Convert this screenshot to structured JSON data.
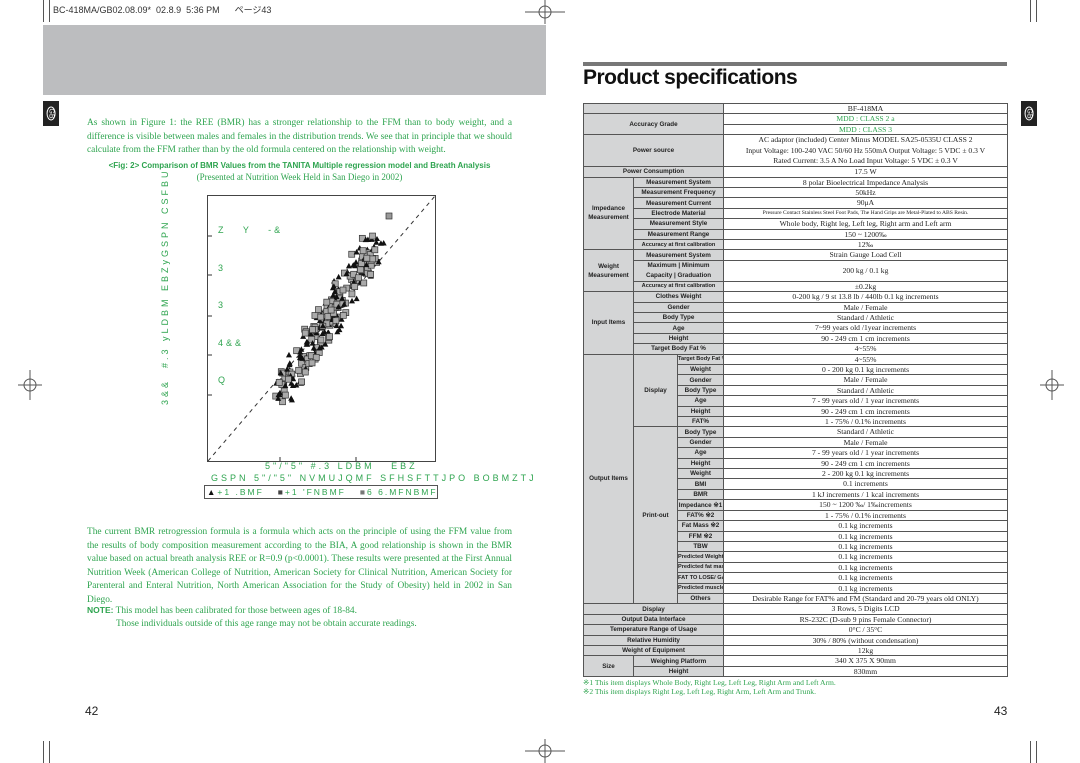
{
  "print_header": "BC-418MA/GB02.08.09*  02.8.9  5:36 PM      ページ43",
  "left_page": {
    "tab": "GB",
    "intro": "As shown in Figure 1: the REE (BMR) has a stronger relationship to the FFM than to body weight, and a difference is visible between males and females in the distribution trends. We see that in principle that we should calculate from the FFM rather than by the old formula centered on the relationship with weight.",
    "figure_caption": "<Fig:  2> Comparison of BMR Values from the TANITA Multiple regression model and Breath Analysis",
    "figure_subcaption": "(Presented at Nutrition Week Held in San Diego in 2002)",
    "figure": {
      "y_label": "3&&  #.3 yLDBM EBZyGSPN CSFBU",
      "inset_lines": [
        "Z   Y   -&",
        "3",
        "3",
        "4&&",
        "Q"
      ],
      "x_label_1": "5\"/\"5\" #.3 LDBM   EBZ",
      "x_label_2": "GSPN 5\"/\"5\" NVMUJQMF SFHSFTTJPO BOBMZTJ",
      "legend": [
        "+1 .BMF",
        "+1 'FNBMF",
        "6 6.MFNBMF"
      ]
    },
    "body": "The current BMR retrogression formula is a formula which acts on the principle of using the FFM value from the results of body composition measurement according to the BIA, A good relationship is shown in the BMR value based on actual breath analysis REE or R=0.9 (p<0.0001). These results were presented at the First Annual Nutrition Week (American College of Nutrition, American Society for Clinical Nutrition, American Society for Parenteral and Enteral Nutrition, North American Association for the Study of Obesity) held in 2002 in San Diego.",
    "note_label": "NOTE:",
    "note_1": "This model has been calibrated for those between ages of 18-84.",
    "note_2": "Those individuals outside of this age range may not be obtain accurate readings.",
    "page_number": "42"
  },
  "right_page": {
    "tab": "GB",
    "title": "Product specifications",
    "page_number": "43",
    "accent_color": "#2ea44f",
    "specs": [
      {
        "label": "",
        "values": [
          "BF-418MA"
        ]
      },
      {
        "label": "Accuracy Grade",
        "values": [
          "MDD : CLASS 2 a",
          "MDD : CLASS 3"
        ],
        "highlight": true
      },
      {
        "label": "Power source",
        "lines": [
          "AC adaptor (included)  Center Minus  MODEL SA25-0535U  CLASS 2",
          "Input Voltage: 100-240 VAC  50/60 Hz  550mA  Output Voltage: 5 VDC ± 0.3 V",
          "Rated Current: 3.5 A   No Load Input Voltage: 5 VDC ± 0.3 V"
        ]
      },
      {
        "label": "Power Consumption",
        "values": [
          "17.5 W"
        ]
      },
      {
        "label": "Impedance Measurement",
        "items": [
          {
            "label": "Measurement System",
            "value": "8 polar Bioelectrical Impedance Analysis"
          },
          {
            "label": "Measurement Frequency",
            "value": "50kHz"
          },
          {
            "label": "Measurement Current",
            "value": "90μA"
          },
          {
            "label": "Electrode Material",
            "value": "Pressure Contact Stainless Steel Foot Pads, The Hand Grips are Metal-Plated to ABS Resin."
          },
          {
            "label": "Measurement Style",
            "value": "Whole body, Right leg, Left leg, Right arm and Left arm"
          },
          {
            "label": "Measurement Range",
            "value": "150 ~ 1200‰"
          },
          {
            "label": "Accuracy at first calibration",
            "value": "12‰"
          }
        ]
      },
      {
        "label": "Weight Measurement",
        "items": [
          {
            "label": "Measurement System",
            "value": "Strain Gauge Load Cell"
          },
          {
            "label_lines": [
              "Maximum  |  Minimum",
              "Capacity  |  Graduation"
            ],
            "value": "200 kg / 0.1 kg"
          },
          {
            "label": "Accuracy at first calibration",
            "value": "±0.2kg"
          }
        ]
      },
      {
        "label": "Input Items",
        "items": [
          {
            "label": "Clothes Weight",
            "value": "0-200 kg / 9 st 13.8 lb / 440lb      0.1 kg increments"
          },
          {
            "label": "Gender",
            "value": "Male / Female"
          },
          {
            "label": "Body Type",
            "value": "Standard / Athletic"
          },
          {
            "label": "Age",
            "value": "7~99 years old /1year increments"
          },
          {
            "label": "Height",
            "value": "90 - 249 cm        1 cm increments"
          },
          {
            "label": "Target Body Fat %",
            "value": "4~55%"
          }
        ]
      },
      {
        "label": "Output Items",
        "groups": [
          {
            "label": "Display",
            "items": [
              {
                "label": "Target Body Fat %",
                "value": "4~55%"
              },
              {
                "label": "Weight",
                "value": "0 - 200 kg      0.1 kg increments"
              },
              {
                "label": "Gender",
                "value": "Male / Female"
              },
              {
                "label": "Body Type",
                "value": "Standard / Athletic"
              },
              {
                "label": "Age",
                "value": "7 - 99 years old / 1 year increments"
              },
              {
                "label": "Height",
                "value": "90 - 249 cm        1 cm increments"
              },
              {
                "label": "FAT%",
                "value": "1 - 75% / 0.1% increments"
              }
            ]
          },
          {
            "label": "Print-out",
            "items": [
              {
                "label": "Body Type",
                "value": "Standard / Athletic"
              },
              {
                "label": "Gender",
                "value": "Male / Female"
              },
              {
                "label": "Age",
                "value": "7 - 99 years old / 1 year increments"
              },
              {
                "label": "Height",
                "value": "90 - 249 cm        1 cm increments"
              },
              {
                "label": "Weight",
                "value": "2 - 200 kg     0.1 kg increments"
              },
              {
                "label": "BMI",
                "value": "0.1 increments"
              },
              {
                "label": "BMR",
                "value": "1 kJ increments / 1 kcal increments"
              },
              {
                "label": "Impedance ※1",
                "value": "150 ~ 1200 ‰/ 1‰increments"
              },
              {
                "label": "FAT% ※2",
                "value": "1 - 75% / 0.1% increments"
              },
              {
                "label": "Fat Mass ※2",
                "value": "0.1 kg increments"
              },
              {
                "label": "FFM ※2",
                "value": "0.1 kg increments"
              },
              {
                "label": "TBW",
                "value": "0.1 kg increments"
              },
              {
                "label": "Predicted Weight",
                "value": "0.1 kg increments"
              },
              {
                "label": "Predicted fat mass",
                "value": "0.1 kg increments"
              },
              {
                "label": "FAT TO LOSE/ GAIN",
                "value": "0.1 kg increments"
              },
              {
                "label": "Predicted muscle Mass ※2",
                "value": "0.1 kg increments"
              },
              {
                "label": "Others",
                "value": "Desirable Range for FAT% and FM (Standard and 20-79 years old ONLY)"
              }
            ]
          }
        ]
      },
      {
        "label": "Display",
        "values": [
          "3 Rows, 5 Digits LCD"
        ]
      },
      {
        "label": "Output Data Interface",
        "values": [
          "RS-232C (D-sub 9 pins Female Connector)"
        ]
      },
      {
        "label": "Temperature Range of Usage",
        "values": [
          "0°C / 35°C"
        ]
      },
      {
        "label": "Relative Humidity",
        "values": [
          "30% / 80% (without condensation)"
        ]
      },
      {
        "label": "Weight of Equipment",
        "values": [
          "12kg"
        ]
      },
      {
        "label": "Size",
        "items": [
          {
            "label": "Weighing Platform",
            "value": "340 X 375 X 90mm"
          },
          {
            "label": "Height",
            "value": "830mm"
          }
        ]
      }
    ],
    "footnotes": [
      "※1   This item displays Whole Body, Right Leg, Left Leg, Right Arm and Left Arm.",
      "※2   This item displays Right Leg, Left Leg, Right Arm, Left Arm and Trunk."
    ]
  }
}
